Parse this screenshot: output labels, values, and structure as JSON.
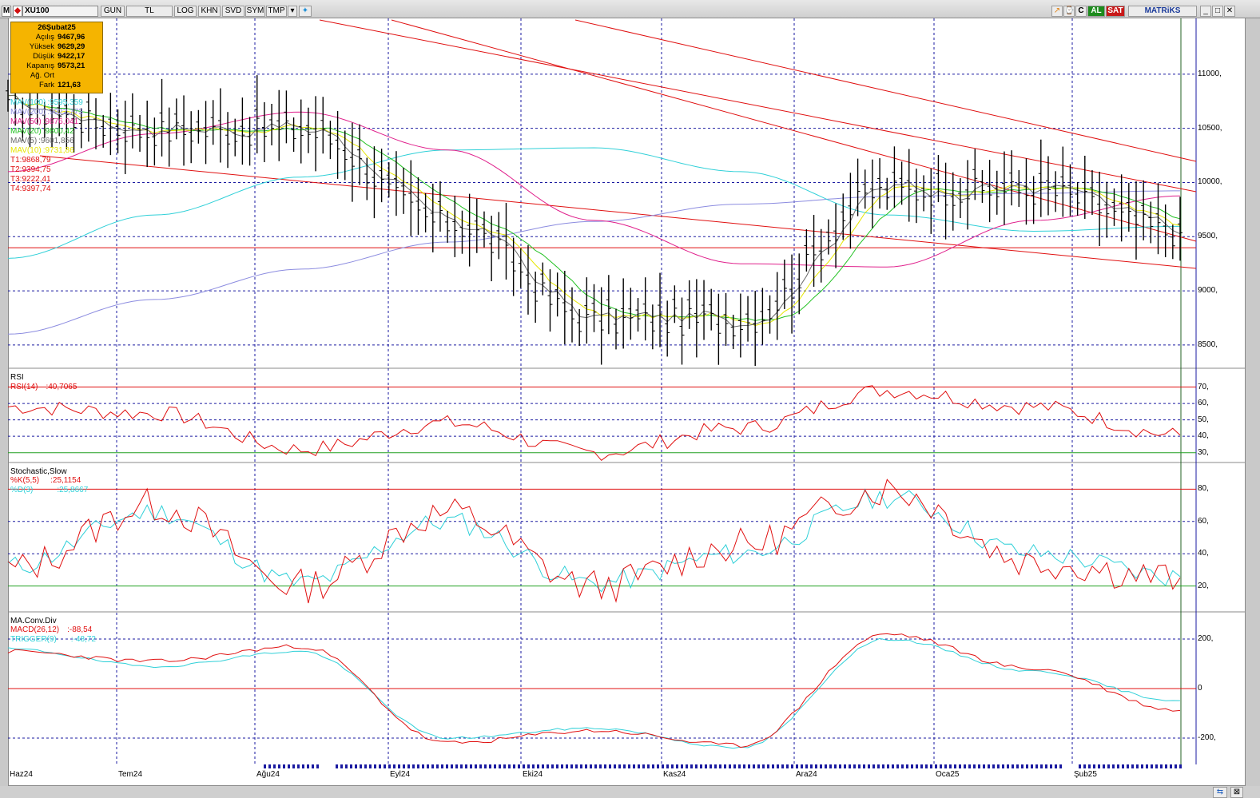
{
  "toolbar": {
    "m_label": "M",
    "symbol": "XU100",
    "period": "GUN",
    "currency": "TL",
    "buttons": [
      "LOG",
      "KHN",
      "SVD",
      "SYM",
      "TMP"
    ],
    "right_c": "C",
    "buy": "AL",
    "sell": "SAT",
    "brand": "MATRiKS"
  },
  "infobox": {
    "date": "26Şubat25",
    "rows": [
      {
        "label": "Açılış",
        "value": "9467,96"
      },
      {
        "label": "Yüksek",
        "value": "9629,29"
      },
      {
        "label": "Düşük",
        "value": "9422,17"
      },
      {
        "label": "Kapanış",
        "value": "9573,21"
      },
      {
        "label": "Ağ. Ort",
        "value": ""
      },
      {
        "label": "Fark",
        "value": "121,63"
      }
    ]
  },
  "legend": [
    {
      "text": "MAV(100)",
      "value": ":9595,359",
      "color": "#30d0d8"
    },
    {
      "text": "MAV(200)",
      "value": ":9922,773",
      "color": "#8c8ce0"
    },
    {
      "text": "MAV(50)",
      "value": ":9876,041",
      "color": "#e0208c"
    },
    {
      "text": "MAV(20)",
      "value": ":9800,42",
      "color": "#20c020"
    },
    {
      "text": "MAV(5)",
      "value": ":9601,856",
      "color": "#6a6a6a"
    },
    {
      "text": "MAV(10)",
      "value": ":9731,86",
      "color": "#e6e600"
    },
    {
      "text": "T1:9868,79",
      "value": "",
      "color": "#e01010"
    },
    {
      "text": "T2:9394,75",
      "value": "",
      "color": "#e01010"
    },
    {
      "text": "T3:9222,41",
      "value": "",
      "color": "#e01010"
    },
    {
      "text": "T4:9397,74",
      "value": "",
      "color": "#e01010"
    }
  ],
  "price_axis": [
    "11000,",
    "10500,",
    "10000,",
    "9500,",
    "9000,",
    "8500,"
  ],
  "rsi": {
    "title": "RSI",
    "label": "RSI(14)",
    "value": ":40,7065",
    "axis": [
      "70,",
      "60,",
      "50,",
      "40,",
      "30,"
    ]
  },
  "stoch": {
    "title": "Stochastic,Slow",
    "k_label": "%K(5,5)",
    "k_value": ":25,1154",
    "d_label": "%D(3)",
    "d_value": ":25,8667",
    "axis": [
      "80,",
      "60,",
      "40,",
      "20,"
    ]
  },
  "macd": {
    "title": "MA.Conv.Div",
    "macd_label": "MACD(26,12)",
    "macd_value": ":-88,54",
    "trig_label": "TRIGGER(9)",
    "trig_value": ":-48,72",
    "axis": [
      "200,",
      "0",
      "-200,"
    ]
  },
  "dates": [
    "Haz24",
    "Tem24",
    "Ağu24",
    "Eyl24",
    "Eki24",
    "Kas24",
    "Ara24",
    "Oca25",
    "Şub25"
  ],
  "colors": {
    "grid": "#1a1aa0",
    "red": "#e01010",
    "green": "#20a020",
    "cyan": "#30d0d8",
    "bar": "#000000"
  },
  "chart_data": [
    {
      "type": "line",
      "title": "XU100",
      "x": [
        "Haz24",
        "Tem24",
        "Ağu24",
        "Eyl24",
        "Eki24",
        "Kas24",
        "Ara24",
        "Oca25",
        "Şub25"
      ],
      "ylim": [
        8300,
        11500
      ],
      "series": [
        {
          "name": "XU100",
          "values": [
            10700,
            10500,
            10500,
            9650,
            8750,
            8750,
            9950,
            9950,
            9573
          ]
        },
        {
          "name": "MAV(200)",
          "values": [
            8600,
            8920,
            9200,
            9450,
            9640,
            9800,
            9870,
            9900,
            9923
          ]
        },
        {
          "name": "MAV(100)",
          "values": [
            9300,
            9700,
            10050,
            10300,
            10320,
            10100,
            9700,
            9550,
            9595
          ]
        },
        {
          "name": "MAV(50)",
          "values": [
            10100,
            10450,
            10650,
            10300,
            9650,
            9250,
            9220,
            9650,
            9876
          ]
        }
      ]
    },
    {
      "type": "line",
      "title": "RSI",
      "x": [
        "Haz24",
        "Tem24",
        "Ağu24",
        "Eyl24",
        "Eki24",
        "Kas24",
        "Ara24",
        "Oca25",
        "Şub25"
      ],
      "ylim": [
        25,
        80
      ],
      "series": [
        {
          "name": "RSI(14)",
          "values": [
            58,
            54,
            32,
            48,
            30,
            45,
            68,
            58,
            40.7065
          ]
        }
      ]
    },
    {
      "type": "line",
      "title": "Stochastic,Slow",
      "x": [
        "Haz24",
        "Tem24",
        "Ağu24",
        "Eyl24",
        "Eki24",
        "Kas24",
        "Ara24",
        "Oca25",
        "Şub25"
      ],
      "ylim": [
        5,
        95
      ],
      "series": [
        {
          "name": "%K(5,5)",
          "values": [
            30,
            70,
            20,
            65,
            20,
            45,
            80,
            35,
            25.1154
          ]
        },
        {
          "name": "%D(3)",
          "values": [
            32,
            66,
            22,
            60,
            22,
            40,
            75,
            40,
            25.8667
          ]
        }
      ]
    },
    {
      "type": "line",
      "title": "MA.Conv.Div",
      "x": [
        "Haz24",
        "Tem24",
        "Ağu24",
        "Eyl24",
        "Eki24",
        "Kas24",
        "Ara24",
        "Oca25",
        "Şub25"
      ],
      "ylim": [
        -300,
        300
      ],
      "series": [
        {
          "name": "MACD(26,12)",
          "values": [
            150,
            110,
            170,
            -220,
            -170,
            -230,
            220,
            80,
            -88.54
          ]
        },
        {
          "name": "TRIGGER(9)",
          "values": [
            160,
            90,
            150,
            -200,
            -160,
            -240,
            200,
            70,
            -48.72
          ]
        }
      ]
    }
  ]
}
